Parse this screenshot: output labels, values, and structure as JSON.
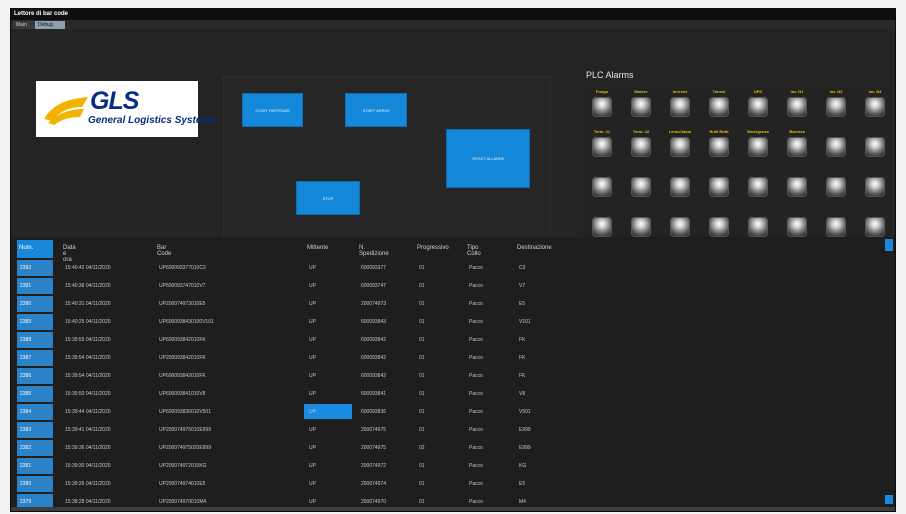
{
  "window": {
    "title": "Lettore di bar code"
  },
  "tabs": [
    {
      "label": "Main"
    },
    {
      "label": "Debug"
    }
  ],
  "logo": {
    "name": "GLS",
    "subtitle": "General Logistics Systems"
  },
  "controls": {
    "start_partenze": "START PARTENZE",
    "start_arrivi": "START ARRIVI",
    "reset_allarmi": "RESET ALLARMI",
    "stop": "STOP"
  },
  "plc": {
    "title": "PLC Alarms",
    "rows": [
      [
        "Fungo",
        "Motore",
        "Inverter",
        "Tunnel",
        "UPS",
        "Inv. N1",
        "Inv. N2",
        "Inv. N3"
      ],
      [
        "Term. 21",
        "Term. 22",
        "Lento/Jasto",
        "Rulli Rotti",
        "Emergenza",
        "Barriera",
        "",
        ""
      ],
      [
        "",
        "",
        "",
        "",
        "",
        "",
        "",
        ""
      ],
      [
        "",
        "",
        "",
        "",
        "",
        "",
        "",
        ""
      ]
    ]
  },
  "table": {
    "headers": [
      "Num.",
      "Data e ora",
      "Bar Code",
      "Mittente",
      "N. Spedizione",
      "Progressivo",
      "Tipo Collo",
      "Destinazione"
    ],
    "rows": [
      [
        "2392",
        "15:40:42 04/11/2020",
        "UP600093377010C3",
        "UP",
        "600093377",
        "01",
        "Pacco",
        "C3"
      ],
      [
        "2391",
        "15:40:36 04/11/2020",
        "UP600093747010V7",
        "UP",
        "600093747",
        "01",
        "Pacco",
        "V7"
      ],
      [
        "2390",
        "15:40:31 04/11/2020",
        "UP200074973010E5",
        "UP",
        "200074973",
        "01",
        "Pacco",
        "E5"
      ],
      [
        "2389",
        "15:40:25 04/11/2020",
        "UP6000938430100V101",
        "UP",
        "600093843",
        "01",
        "Pacco",
        "V101"
      ],
      [
        "2388",
        "15:39:55 04/11/2020",
        "UP600093842010FK",
        "UP",
        "600093842",
        "01",
        "Pacco",
        "FK"
      ],
      [
        "2387",
        "15:39:54 04/11/2020",
        "UP200093842010FK",
        "UP",
        "600093842",
        "01",
        "Pacco",
        "FK"
      ],
      [
        "2386",
        "15:39:54 04/11/2020",
        "UP600093842010FK",
        "UP",
        "600093842",
        "01",
        "Pacco",
        "FK"
      ],
      [
        "2385",
        "15:39:50 04/11/2020",
        "UP600093841010V8",
        "UP",
        "600093841",
        "01",
        "Pacco",
        "V8"
      ],
      [
        "2384",
        "15:39:44 04/11/2020",
        "UP600093836010V501",
        "UP",
        "600093836",
        "01",
        "Pacco",
        "V501"
      ],
      [
        "2383",
        "15:39:41 04/11/2020",
        "UP200074975010E999",
        "UP",
        "200074975",
        "01",
        "Pacco",
        "E999"
      ],
      [
        "2382",
        "15:39:36 04/11/2020",
        "UP200074975020E999",
        "UP",
        "200074975",
        "02",
        "Pacco",
        "E999"
      ],
      [
        "2381",
        "15:39:30 04/11/2020",
        "UP200074972010KG",
        "UP",
        "200074972",
        "01",
        "Pacco",
        "KG"
      ],
      [
        "2380",
        "15:39:26 04/11/2020",
        "UP200074974010E5",
        "UP",
        "200074974",
        "01",
        "Pacco",
        "E5"
      ],
      [
        "2379",
        "15:38:28 04/11/2020",
        "UP200074970010M4",
        "UP",
        "200074970",
        "01",
        "Pacco",
        "M4"
      ]
    ],
    "highlighted_row": 8
  },
  "colors": {
    "accent": "#1387d8",
    "alarm_label": "#e7c200",
    "background": "#1c1c1c",
    "logo_text": "#062c84",
    "logo_swoosh": "#f2b300"
  },
  "icons": [
    "gls-swoosh-logo",
    "alarm-lamp-icon",
    "scroll-up-icon",
    "scroll-down-icon"
  ]
}
